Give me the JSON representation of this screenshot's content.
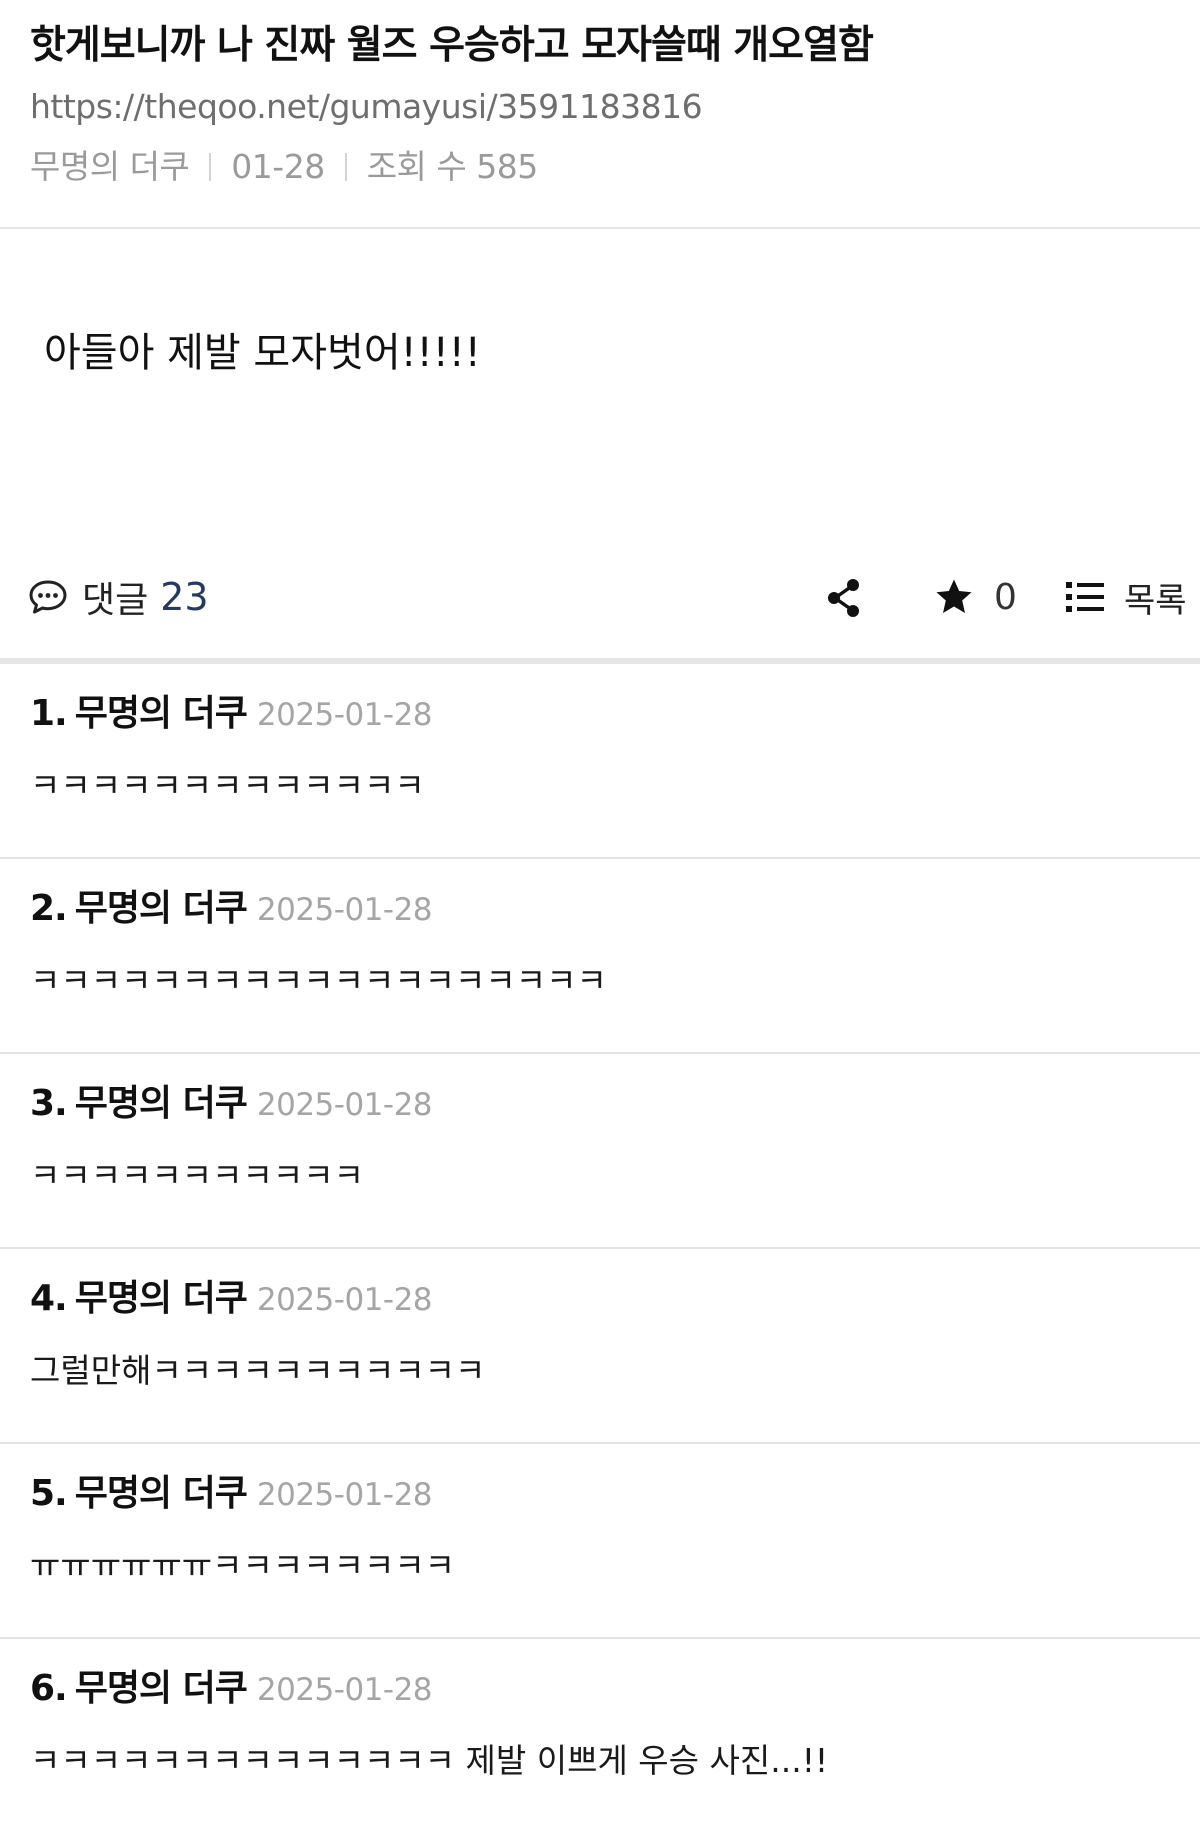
{
  "post": {
    "title": "핫게보니까 나 진짜 월즈 우승하고 모자쓸때 개오열함",
    "url": "https://theqoo.net/gumayusi/3591183816",
    "author": "무명의 더쿠",
    "date": "01-28",
    "views_label": "조회 수 585",
    "content": "아들아 제발 모자벗어!!!!!"
  },
  "actions": {
    "comment_label": "댓글",
    "comment_count": "23",
    "star_count": "0",
    "list_label": "목록",
    "icons": [
      "speech-bubble-icon",
      "share-icon",
      "star-icon",
      "list-icon"
    ],
    "comment_count_color": "#243a63"
  },
  "comments": [
    {
      "num": "1.",
      "author": "무명의 더쿠",
      "date": "2025-01-28",
      "text": "ㅋㅋㅋㅋㅋㅋㅋㅋㅋㅋㅋㅋㅋ"
    },
    {
      "num": "2.",
      "author": "무명의 더쿠",
      "date": "2025-01-28",
      "text": "ㅋㅋㅋㅋㅋㅋㅋㅋㅋㅋㅋㅋㅋㅋㅋㅋㅋㅋㅋ"
    },
    {
      "num": "3.",
      "author": "무명의 더쿠",
      "date": "2025-01-28",
      "text": "ㅋㅋㅋㅋㅋㅋㅋㅋㅋㅋㅋ"
    },
    {
      "num": "4.",
      "author": "무명의 더쿠",
      "date": "2025-01-28",
      "text": "그럴만해ㅋㅋㅋㅋㅋㅋㅋㅋㅋㅋㅋ"
    },
    {
      "num": "5.",
      "author": "무명의 더쿠",
      "date": "2025-01-28",
      "text": "ㅠㅠㅠㅠㅠㅠㅋㅋㅋㅋㅋㅋㅋㅋ"
    },
    {
      "num": "6.",
      "author": "무명의 더쿠",
      "date": "2025-01-28",
      "text": "ㅋㅋㅋㅋㅋㅋㅋㅋㅋㅋㅋㅋㅋㅋ 제발 이쁘게 우승 사진...!!"
    }
  ]
}
